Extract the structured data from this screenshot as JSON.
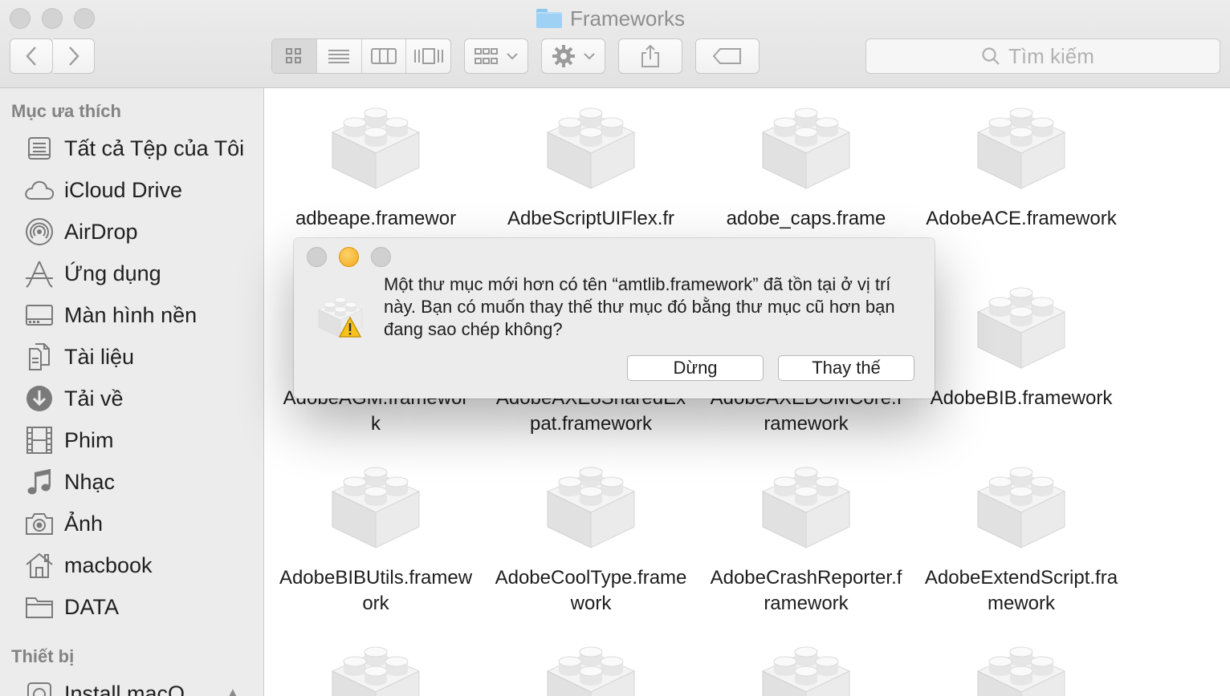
{
  "window": {
    "title": "Frameworks"
  },
  "toolbar": {
    "back_icon": "chevron-left-icon",
    "forward_icon": "chevron-right-icon",
    "view_modes": [
      "icon-view",
      "list-view",
      "column-view",
      "cover-flow-view"
    ],
    "active_view": "icon-view",
    "search_placeholder": "Tìm kiếm"
  },
  "sidebar": {
    "favorites_heading": "Mục ưa thích",
    "items": [
      {
        "label": "Tất cả Tệp của Tôi",
        "icon": "all-files-icon"
      },
      {
        "label": "iCloud Drive",
        "icon": "cloud-icon"
      },
      {
        "label": "AirDrop",
        "icon": "airdrop-icon"
      },
      {
        "label": "Ứng dụng",
        "icon": "applications-icon"
      },
      {
        "label": "Màn hình nền",
        "icon": "desktop-icon"
      },
      {
        "label": "Tài liệu",
        "icon": "document-icon"
      },
      {
        "label": "Tải về",
        "icon": "download-icon"
      },
      {
        "label": "Phim",
        "icon": "film-icon"
      },
      {
        "label": "Nhạc",
        "icon": "music-icon"
      },
      {
        "label": "Ảnh",
        "icon": "camera-icon"
      },
      {
        "label": "macbook",
        "icon": "home-icon"
      },
      {
        "label": "DATA",
        "icon": "folder-icon"
      }
    ],
    "devices_heading": "Thiết bị",
    "devices": [
      {
        "label": "Install macO",
        "icon": "disk-icon"
      }
    ]
  },
  "files": [
    "adbeape.framewor",
    "AdbeScriptUIFlex.fr",
    "adobe_caps.frame",
    "AdobeACE.framework",
    "AdobeAGM.framework",
    "AdobeAXE8SharedExpat.framework",
    "AdobeAXEDOMCore.framework",
    "AdobeBIB.framework",
    "AdobeBIBUtils.framework",
    "AdobeCoolType.framework",
    "AdobeCrashReporter.framework",
    "AdobeExtendScript.framework"
  ],
  "dialog": {
    "message": "Một thư mục mới hơn có tên “amtlib.framework” đã tồn tại ở vị trí này. Bạn có muốn thay thế thư mục đó bằng thư mục cũ hơn bạn đang sao chép không?",
    "stop_label": "Dừng",
    "replace_label": "Thay thế",
    "icon": "framework-warning-icon"
  },
  "colors": {
    "minimize": "#f4a91b",
    "sidebar_bg": "#ececec"
  }
}
